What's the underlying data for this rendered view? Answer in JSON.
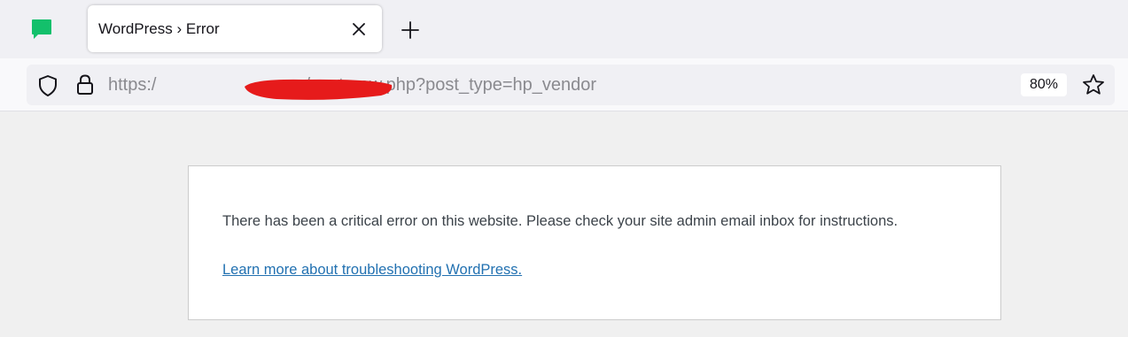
{
  "browser": {
    "pinned_tab_icon": "green-chat-bubble-icon",
    "active_tab": {
      "title": "WordPress › Error",
      "close_icon": "close-icon"
    },
    "new_tab_icon": "plus-icon"
  },
  "address_bar": {
    "url_prefix": "https:/",
    "url_suffix": "/post-new.php?post_type=hp_vendor",
    "zoom_level": "80%",
    "icons": [
      "shield-icon",
      "lock-icon",
      "star-icon"
    ]
  },
  "page": {
    "error_message": "There has been a critical error on this website. Please check your site admin email inbox for instructions.",
    "help_link": "Learn more about troubleshooting WordPress."
  },
  "colors": {
    "link": "#2271b1",
    "text": "#3c434a",
    "redaction": "#e61b1b",
    "pinned_icon": "#13c06b"
  }
}
